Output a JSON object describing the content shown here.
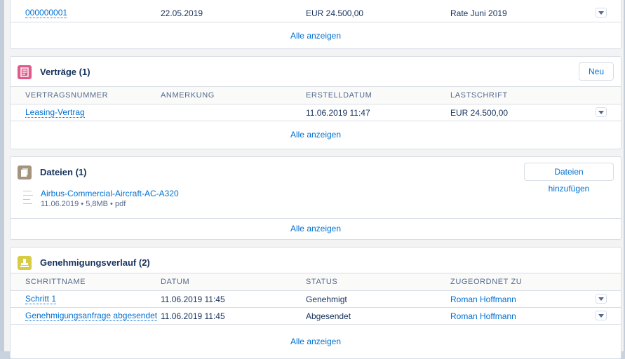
{
  "payments": {
    "rows": [
      {
        "number": "000000001",
        "date": "22.05.2019",
        "amount": "EUR 24.500,00",
        "description": "Rate Juni 2019"
      }
    ],
    "show_all": "Alle anzeigen"
  },
  "contracts": {
    "title": "Verträge",
    "count": "(1)",
    "new_button": "Neu",
    "icon": "contract-icon",
    "icon_color": "#e05a8b",
    "columns": [
      "VERTRAGSNUMMER",
      "ANMERKUNG",
      "ERSTELLDATUM",
      "LASTSCHRIFT"
    ],
    "rows": [
      {
        "number": "Leasing-Vertrag",
        "note": "",
        "created": "11.06.2019 11:47",
        "debit": "EUR 24.500,00"
      }
    ],
    "show_all": "Alle anzeigen"
  },
  "files": {
    "title": "Dateien",
    "count": "(1)",
    "add_button": "Dateien hinzufügen",
    "icon": "files-icon",
    "icon_color": "#a4947d",
    "items": [
      {
        "name": "Airbus-Commercial-Aircraft-AC-A320",
        "meta": "11.06.2019 • 5,8MB • pdf"
      }
    ],
    "show_all": "Alle anzeigen"
  },
  "approvals": {
    "title": "Genehmigungsverlauf",
    "count": "(2)",
    "icon": "approval-icon",
    "icon_color": "#d7cc44",
    "columns": [
      "SCHRITTNAME",
      "DATUM",
      "STATUS",
      "ZUGEORDNET ZU"
    ],
    "rows": [
      {
        "step": "Schritt 1",
        "date": "11.06.2019 11:45",
        "status": "Genehmigt",
        "assigned": "Roman Hoffmann"
      },
      {
        "step": "Genehmigungsanfrage abgesendet",
        "date": "11.06.2019 11:45",
        "status": "Abgesendet",
        "assigned": "Roman Hoffmann"
      }
    ],
    "show_all": "Alle anzeigen"
  },
  "colors": {
    "link": "#0070d2",
    "text": "#16325c",
    "muted": "#54698d",
    "border": "#d8dde6"
  }
}
